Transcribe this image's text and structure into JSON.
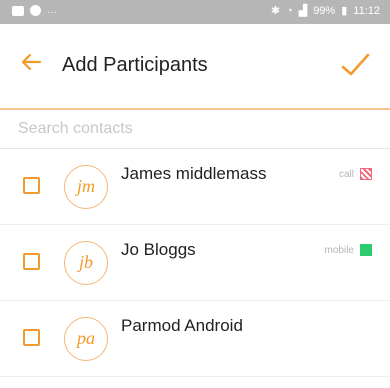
{
  "status_bar": {
    "battery": "99%",
    "time": "11:12"
  },
  "app_bar": {
    "title": "Add Participants",
    "back_icon": "arrow-left-icon",
    "confirm_icon": "checkmark-icon"
  },
  "search": {
    "placeholder": "Search contacts",
    "value": ""
  },
  "contacts": [
    {
      "initials": "jm",
      "name": "James middlemass",
      "status_label": "call",
      "status_color": "#f36a7a",
      "checked": false
    },
    {
      "initials": "jb",
      "name": "Jo Bloggs",
      "status_label": "mobile",
      "status_color": "#2ecc71",
      "checked": false
    },
    {
      "initials": "pa",
      "name": "Parmod Android",
      "status_label": "",
      "status_color": "",
      "checked": false
    }
  ],
  "colors": {
    "accent": "#f19b2c",
    "status_bar": "#b6b6b6"
  }
}
